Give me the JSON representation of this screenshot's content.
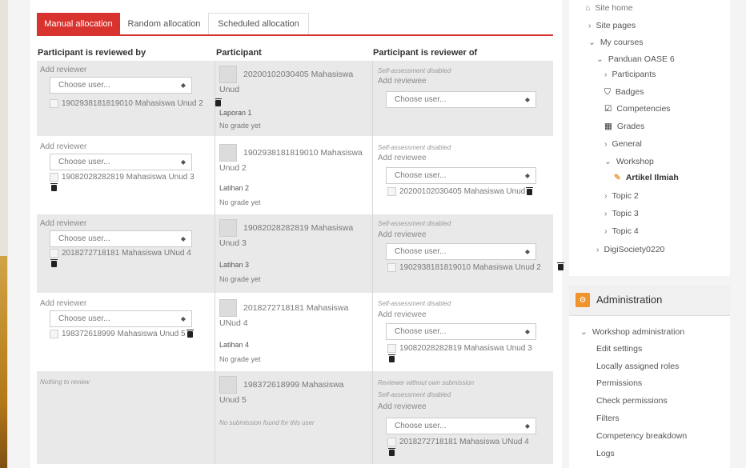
{
  "tabs": [
    "Manual allocation",
    "Random allocation",
    "Scheduled allocation"
  ],
  "columns": [
    "Participant is reviewed by",
    "Participant",
    "Participant is reviewer of"
  ],
  "labels": {
    "add_reviewer": "Add reviewer",
    "add_reviewee": "Add reviewee",
    "choose_user": "Choose user...",
    "self_assessment_disabled": "Self-assessment disabled",
    "nothing_to_review": "Nothing to review",
    "reviewer_without_submission": "Reviewer without own submission",
    "no_submission": "No submission found for this user",
    "no_grade": "No grade yet"
  },
  "rows": [
    {
      "participant_line1": "20200102030405 Mahasiswa",
      "participant_line2": "Unud",
      "submission": "Laporan 1",
      "reviewed_by": "1902938181819010 Mahasiswa Unud 2",
      "reviewer_of": ""
    },
    {
      "participant_line1": "1902938181819010 Mahasiswa",
      "participant_line2": "Unud 2",
      "submission": "Latihan 2",
      "reviewed_by": "19082028282819 Mahasiswa Unud 3",
      "reviewer_of": "20200102030405 Mahasiswa Unud"
    },
    {
      "participant_line1": "19082028282819 Mahasiswa",
      "participant_line2": "Unud 3",
      "submission": "Latihan 3",
      "reviewed_by": "2018272718181 Mahasiswa UNud 4",
      "reviewer_of": "1902938181819010 Mahasiswa Unud 2"
    },
    {
      "participant_line1": "2018272718181 Mahasiswa",
      "participant_line2": "UNud 4",
      "submission": "Latihan 4",
      "reviewed_by": "198372618999 Mahasiswa Unud 5",
      "reviewer_of": "19082028282819 Mahasiswa Unud 3"
    },
    {
      "participant_line1": "198372618999 Mahasiswa",
      "participant_line2": "Unud 5",
      "submission": "",
      "reviewed_by": "",
      "reviewer_of": "2018272718181 Mahasiswa UNud 4"
    }
  ],
  "sidebar": {
    "site_home": "Site home",
    "site_pages": "Site pages",
    "my_courses": "My courses",
    "course": "Panduan OASE 6",
    "participants": "Participants",
    "badges": "Badges",
    "competencies": "Competencies",
    "grades": "Grades",
    "general": "General",
    "workshop": "Workshop",
    "current": "Artikel Ilmiah",
    "topic2": "Topic 2",
    "topic3": "Topic 3",
    "topic4": "Topic 4",
    "other_course": "DigiSociety0220"
  },
  "administration": {
    "title": "Administration",
    "section": "Workshop administration",
    "links": [
      "Edit settings",
      "Locally assigned roles",
      "Permissions",
      "Check permissions",
      "Filters",
      "Competency breakdown",
      "Logs"
    ]
  },
  "colors": {
    "accent": "#d9332f",
    "admin_badge": "#f0932b"
  }
}
